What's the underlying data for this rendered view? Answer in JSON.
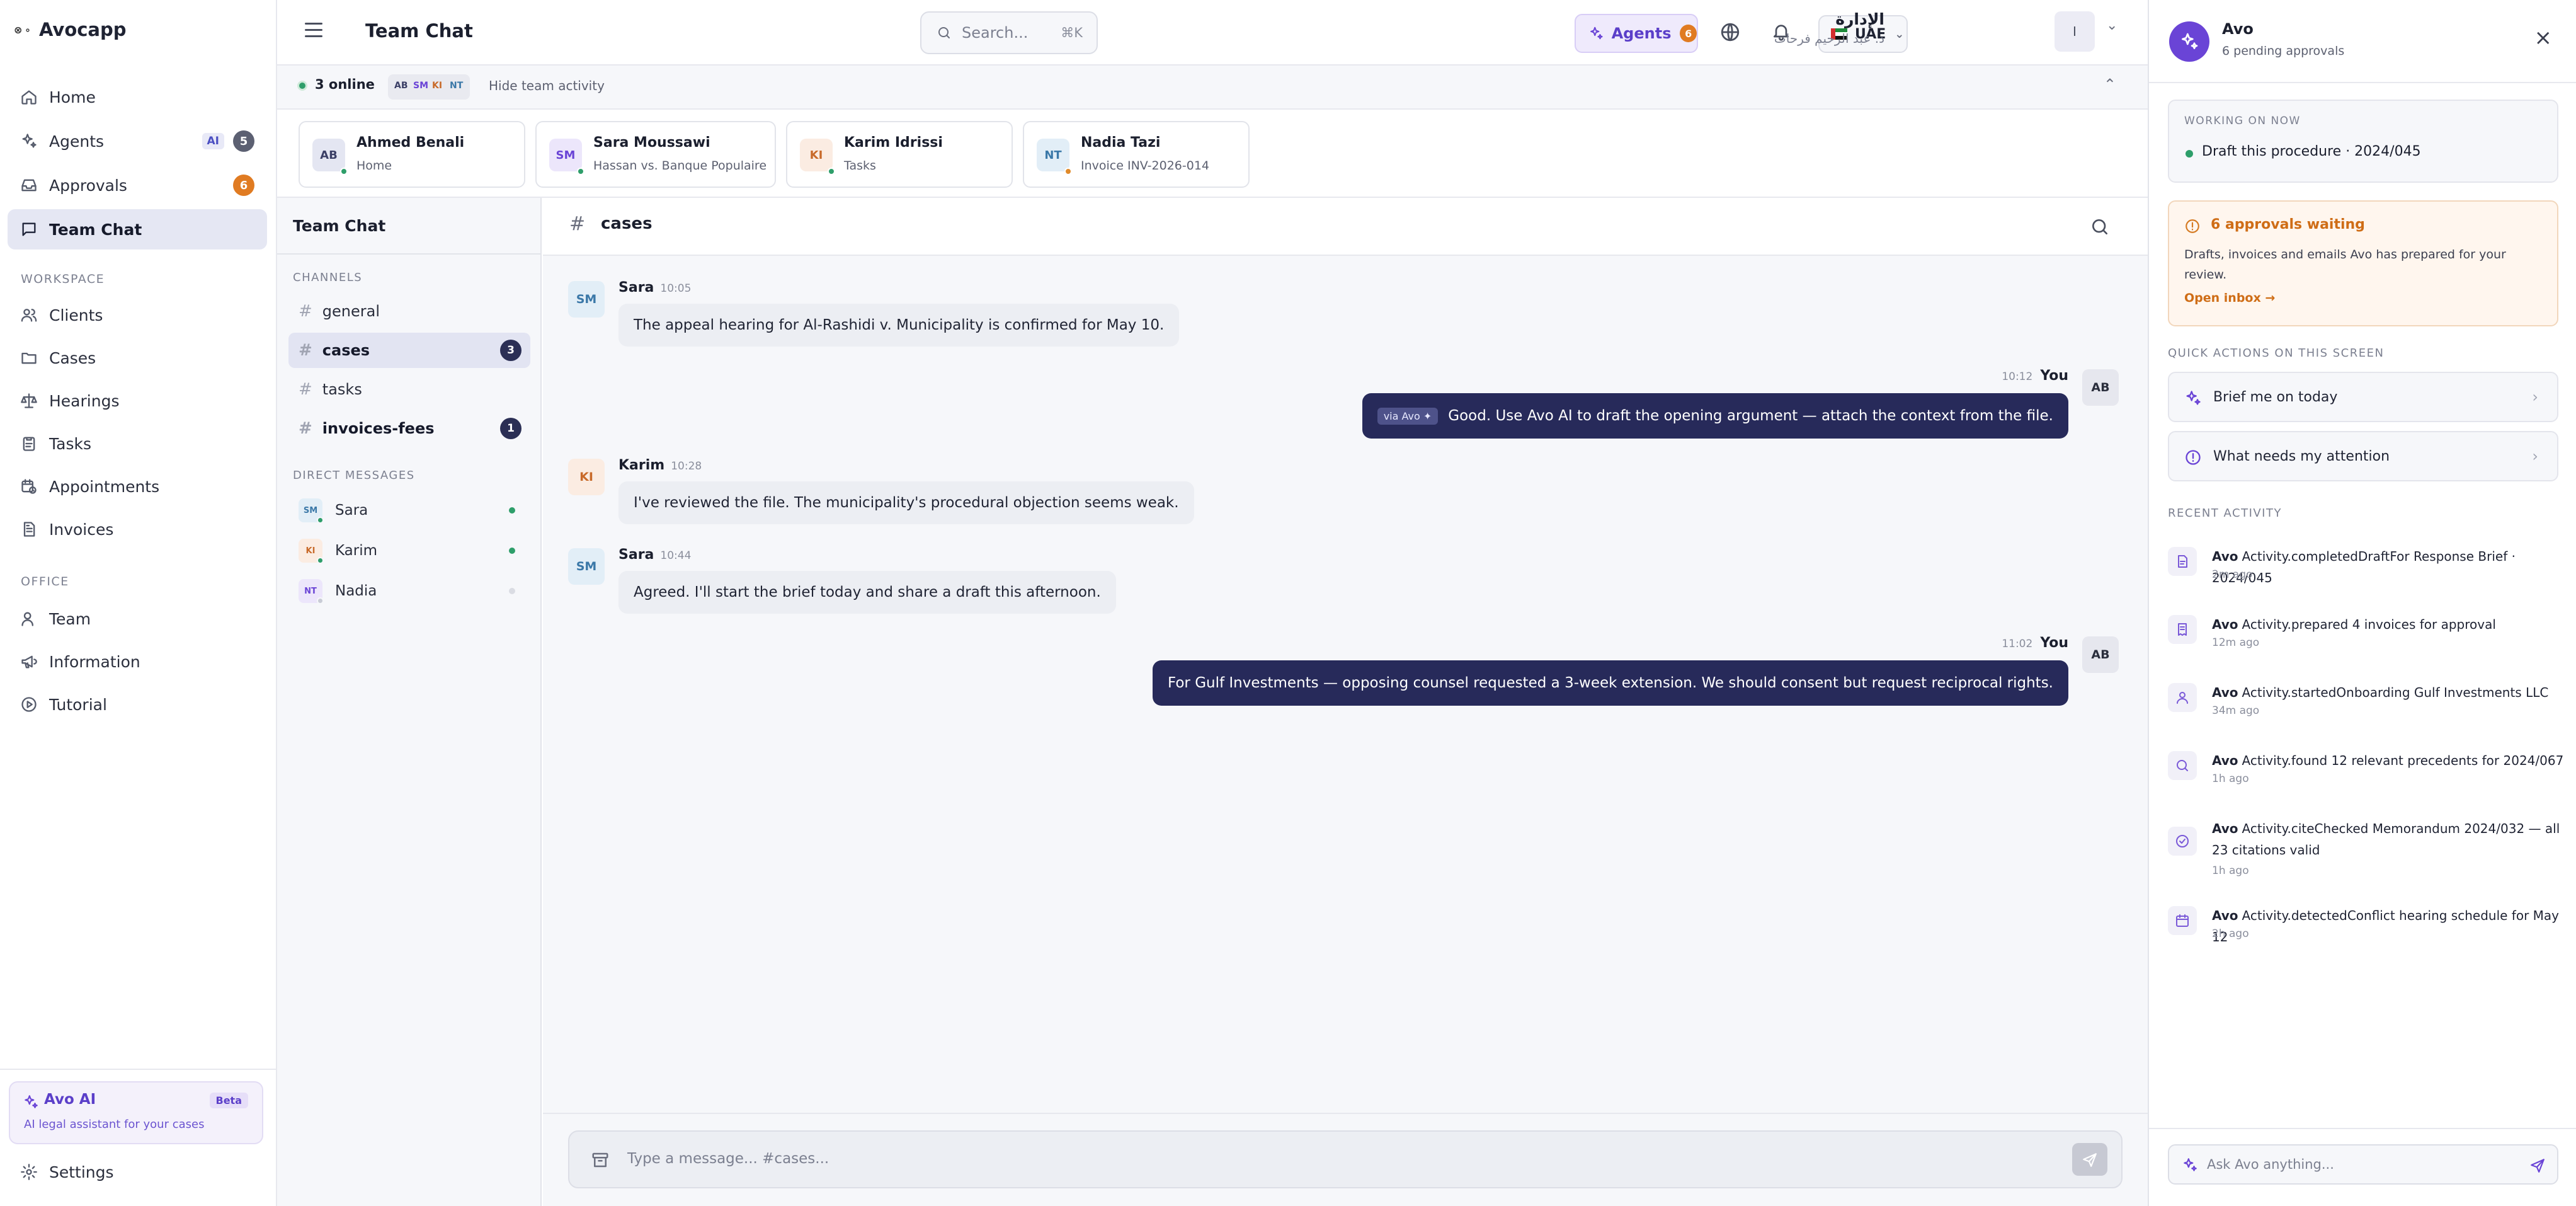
{
  "brand": {
    "name": "Avocapp",
    "mark": "⪠ Avocapp"
  },
  "nav": {
    "items": [
      {
        "label": "Home",
        "icon": "home-icon"
      },
      {
        "label": "Agents",
        "icon": "sparkles-icon",
        "tag": "AI",
        "badge": "5"
      },
      {
        "label": "Approvals",
        "icon": "inbox-icon",
        "badge": "6"
      },
      {
        "label": "Team Chat",
        "icon": "chat-icon",
        "active": true
      }
    ],
    "workspace_label": "WORKSPACE",
    "workspace": [
      {
        "label": "Clients",
        "icon": "users-icon"
      },
      {
        "label": "Cases",
        "icon": "folder-icon"
      },
      {
        "label": "Hearings",
        "icon": "scale-icon"
      },
      {
        "label": "Tasks",
        "icon": "clipboard-icon"
      },
      {
        "label": "Appointments",
        "icon": "calendar-clock-icon"
      },
      {
        "label": "Invoices",
        "icon": "invoice-icon"
      }
    ],
    "office_label": "OFFICE",
    "office": [
      {
        "label": "Team",
        "icon": "team-icon"
      },
      {
        "label": "Information",
        "icon": "megaphone-icon"
      },
      {
        "label": "Tutorial",
        "icon": "play-circle-icon"
      }
    ],
    "avo_card": {
      "title": "Avo AI",
      "tag": "Beta",
      "subtitle": "AI legal assistant for your cases"
    },
    "settings": "Settings"
  },
  "topbar": {
    "title": "Team Chat",
    "search_placeholder": "Search...",
    "search_shortcut": "⌘K",
    "agents_label": "Agents",
    "agents_badge": "6",
    "region": "UAE",
    "user_name": "الإدارة",
    "user_sub": "د. عبد الرحيم فرحات",
    "user_avatar": "I"
  },
  "activity_strip": {
    "online": "3 online",
    "avatars": [
      "AB",
      "SM",
      "KI",
      "NT"
    ],
    "toggle": "Hide team activity"
  },
  "presence": [
    {
      "initials": "AB",
      "name": "Ahmed Benali",
      "sub": "Home",
      "bg": "#e4e6f2",
      "fg": "#3b3f66",
      "dot": "#2e9e6a"
    },
    {
      "initials": "SM",
      "name": "Sara Moussawi",
      "sub": "Hassan vs. Banque Populaire",
      "bg": "#ece6fb",
      "fg": "#6a44d6",
      "dot": "#2e9e6a"
    },
    {
      "initials": "KI",
      "name": "Karim Idrissi",
      "sub": "Tasks",
      "bg": "#fbece2",
      "fg": "#c86a2a",
      "dot": "#2e9e6a"
    },
    {
      "initials": "NT",
      "name": "Nadia Tazi",
      "sub": "Invoice INV-2026-014",
      "bg": "#e2eef7",
      "fg": "#3b78a8",
      "dot": "#e08a2a"
    }
  ],
  "channels": {
    "title": "Team Chat",
    "channels_label": "CHANNELS",
    "items": [
      {
        "name": "general"
      },
      {
        "name": "cases",
        "unread": "3",
        "active": true
      },
      {
        "name": "tasks"
      },
      {
        "name": "invoices-fees",
        "unread": "1",
        "bold": true
      }
    ],
    "dm_label": "DIRECT MESSAGES",
    "dms": [
      {
        "initials": "SM",
        "name": "Sara",
        "bg": "#e2eef7",
        "fg": "#3b78a8",
        "online": true
      },
      {
        "initials": "KI",
        "name": "Karim",
        "bg": "#fbece2",
        "fg": "#c86a2a",
        "online": true
      },
      {
        "initials": "NT",
        "name": "Nadia",
        "bg": "#ece6fb",
        "fg": "#6a44d6",
        "online": false
      }
    ]
  },
  "chat": {
    "channel": "cases",
    "messages": [
      {
        "from": "Sara",
        "initials": "SM",
        "time": "10:05",
        "text": "The appeal hearing for Al-Rashidi v. Municipality is confirmed for May 10.",
        "mine": false
      },
      {
        "from": "You",
        "initials": "AB",
        "time": "10:12",
        "via": "via Avo ✦",
        "text": "Good. Use Avo AI to draft the opening argument — attach the context from the file.",
        "mine": true
      },
      {
        "from": "Karim",
        "initials": "KI",
        "time": "10:28",
        "text": "I've reviewed the file. The municipality's procedural objection seems weak.",
        "mine": false
      },
      {
        "from": "Sara",
        "initials": "SM",
        "time": "10:44",
        "text": "Agreed. I'll start the brief today and share a draft this afternoon.",
        "mine": false
      },
      {
        "from": "You",
        "initials": "AB",
        "time": "11:02",
        "text": "For Gulf Investments — opposing counsel requested a 3-week extension. We should consent but request reciprocal rights.",
        "mine": true
      }
    ],
    "composer_placeholder": "Type a message... #cases..."
  },
  "avo": {
    "title": "Avo",
    "subtitle": "6 pending approvals",
    "working_label": "WORKING ON NOW",
    "working_text": "Draft this procedure · 2024/045",
    "approvals_title": "6 approvals waiting",
    "approvals_text": "Drafts, invoices and emails Avo has prepared for your review.",
    "approvals_link": "Open inbox →",
    "quick_label": "QUICK ACTIONS ON THIS SCREEN",
    "quick": [
      {
        "label": "Brief me on today",
        "icon": "sparkles-icon"
      },
      {
        "label": "What needs my attention",
        "icon": "alert-circle-icon"
      }
    ],
    "recent_label": "RECENT ACTIVITY",
    "activity": [
      {
        "actor": "Avo",
        "text": "Activity.completedDraftFor Response Brief · 2024/045",
        "ago": "2m ago",
        "icon": "document-icon"
      },
      {
        "actor": "Avo",
        "text": "Activity.prepared 4 invoices for approval",
        "ago": "12m ago",
        "icon": "receipt-icon"
      },
      {
        "actor": "Avo",
        "text": "Activity.startedOnboarding Gulf Investments LLC",
        "ago": "34m ago",
        "icon": "user-icon"
      },
      {
        "actor": "Avo",
        "text": "Activity.found 12 relevant precedents for 2024/067",
        "ago": "1h ago",
        "icon": "search-icon"
      },
      {
        "actor": "Avo",
        "text": "Activity.citeChecked Memorandum 2024/032 — all 23 citations valid",
        "ago": "1h ago",
        "icon": "check-circle-icon"
      },
      {
        "actor": "Avo",
        "text": "Activity.detectedConflict hearing schedule for May 12",
        "ago": "2h ago",
        "icon": "calendar-icon"
      }
    ],
    "ask_placeholder": "Ask Avo anything..."
  }
}
